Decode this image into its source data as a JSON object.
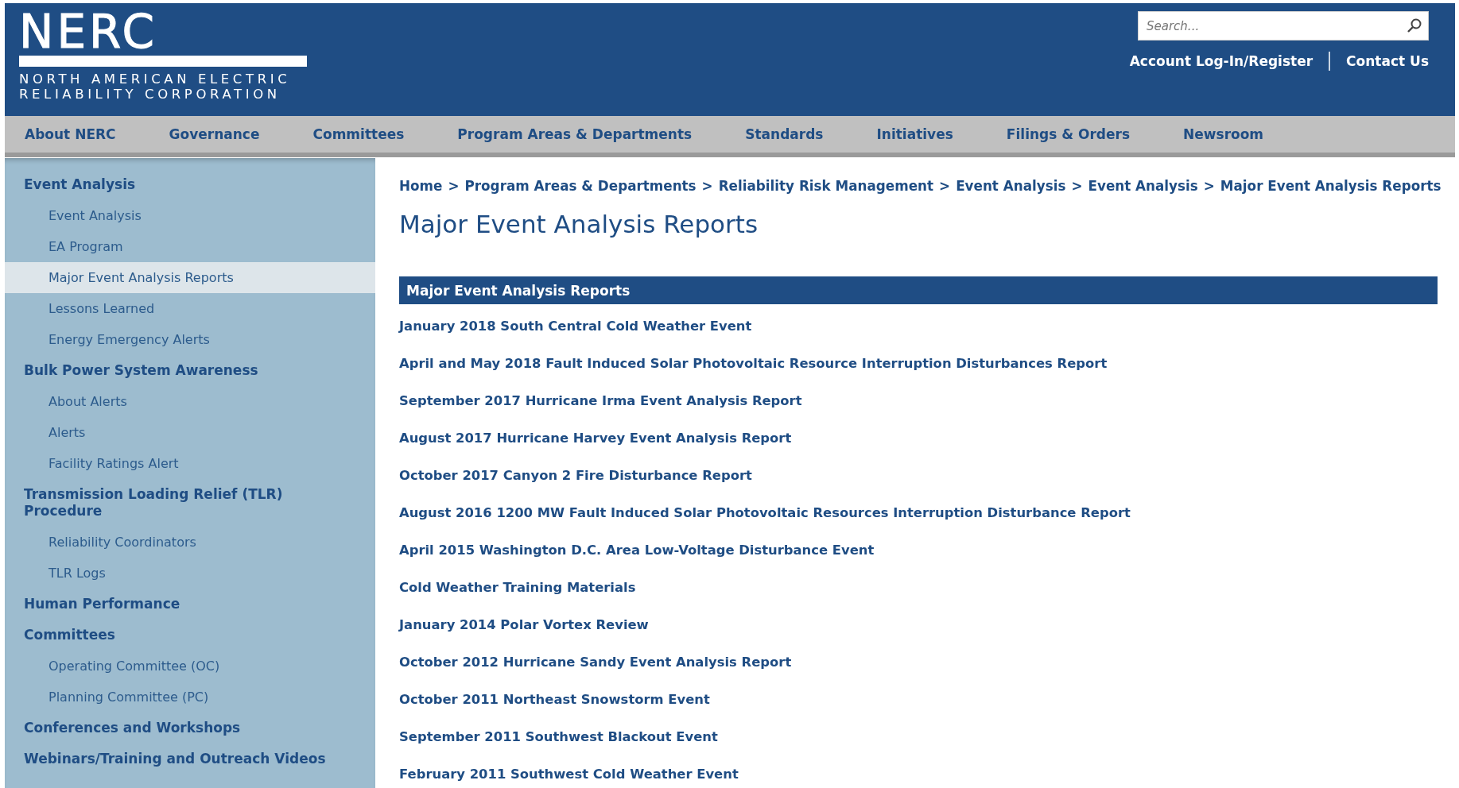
{
  "logo": {
    "wordmark": "NERC",
    "name_lines": [
      "NORTH AMERICAN ELECTRIC",
      "RELIABILITY CORPORATION"
    ]
  },
  "search": {
    "placeholder": "Search..."
  },
  "utility_links": [
    {
      "label": "Account Log-In/Register"
    },
    {
      "label": "Contact Us"
    }
  ],
  "nav": [
    {
      "label": "About NERC"
    },
    {
      "label": "Governance"
    },
    {
      "label": "Committees"
    },
    {
      "label": "Program Areas & Departments"
    },
    {
      "label": "Standards"
    },
    {
      "label": "Initiatives"
    },
    {
      "label": "Filings & Orders"
    },
    {
      "label": "Newsroom"
    }
  ],
  "sidebar": {
    "items": [
      {
        "label": "Event Analysis",
        "selected": false,
        "children": [
          {
            "label": "Event Analysis",
            "selected": false
          },
          {
            "label": "EA Program",
            "selected": false
          },
          {
            "label": "Major Event Analysis Reports",
            "selected": true
          },
          {
            "label": "Lessons Learned",
            "selected": false
          },
          {
            "label": "Energy Emergency Alerts",
            "selected": false
          }
        ]
      },
      {
        "label": "Bulk Power System Awareness",
        "selected": false,
        "children": [
          {
            "label": "About Alerts",
            "selected": false
          },
          {
            "label": "Alerts",
            "selected": false
          },
          {
            "label": "Facility Ratings Alert",
            "selected": false
          }
        ]
      },
      {
        "label": "Transmission Loading Relief (TLR) Procedure",
        "selected": false,
        "children": [
          {
            "label": "Reliability Coordinators",
            "selected": false
          },
          {
            "label": "TLR Logs",
            "selected": false
          }
        ]
      },
      {
        "label": "Human Performance",
        "selected": false
      },
      {
        "label": "Committees",
        "selected": false,
        "children": [
          {
            "label": "Operating Committee (OC)",
            "selected": false
          },
          {
            "label": "Planning Committee (PC)",
            "selected": false
          }
        ]
      },
      {
        "label": "Conferences and Workshops",
        "selected": false
      },
      {
        "label": "Webinars/Training and Outreach Videos",
        "selected": false
      }
    ]
  },
  "breadcrumb": {
    "separator": ">",
    "items": [
      "Home",
      "Program Areas & Departments",
      "Reliability Risk Management",
      "Event Analysis",
      "Event Analysis",
      "Major Event Analysis Reports"
    ]
  },
  "page_title": "Major Event Analysis Reports",
  "reports": {
    "heading": "Major Event Analysis Reports",
    "links": [
      "January 2018 South Central Cold Weather Event",
      "April and May 2018 Fault Induced Solar Photovoltaic Resource Interruption Disturbances Report",
      "September 2017 Hurricane Irma Event Analysis Report",
      "August 2017 Hurricane Harvey Event Analysis Report",
      "October 2017 Canyon 2 Fire Disturbance Report",
      "August 2016 1200 MW Fault Induced Solar Photovoltaic Resources Interruption Disturbance Report",
      "April 2015 Washington D.C. Area Low-Voltage Disturbance Event",
      "Cold Weather Training Materials",
      "January 2014 Polar Vortex Review",
      "October 2012 Hurricane Sandy Event Analysis Report",
      "October 2011 Northeast Snowstorm Event",
      "September 2011 Southwest Blackout Event",
      "February 2011 Southwest Cold Weather Event"
    ]
  }
}
